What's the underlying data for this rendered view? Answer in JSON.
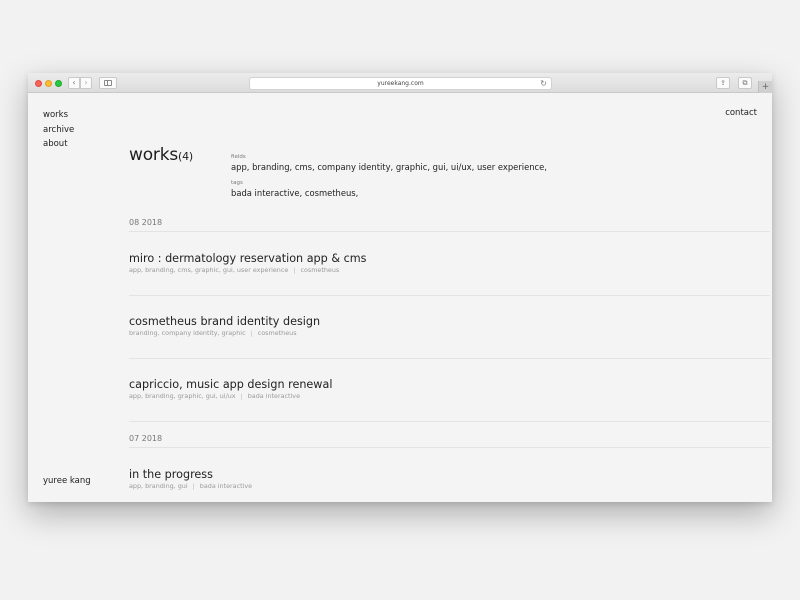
{
  "browser": {
    "url": "yureekang.com",
    "icons": {
      "back": "‹",
      "forward": "›",
      "reload": "↻",
      "share": "⇪",
      "tabs": "⧉",
      "new_tab": "+"
    }
  },
  "nav": {
    "items": [
      {
        "label": "works"
      },
      {
        "label": "archive"
      },
      {
        "label": "about"
      }
    ],
    "contact": "contact",
    "author": "yuree kang"
  },
  "header": {
    "title": "works",
    "count": "(4)",
    "fields_label": "fields",
    "fields_value": "app, branding, cms, company identity, graphic, gui, ui/ux, user experience,",
    "tags_label": "tags",
    "tags_value": "bada interactive, cosmetheus,"
  },
  "groups": [
    {
      "date": "08 2018",
      "projects": [
        {
          "title": "miro : dermatology reservation app & cms",
          "fields": "app, branding, cms, graphic, gui, user experience",
          "sep": "|",
          "tag": "cosmetheus"
        },
        {
          "title": "cosmetheus brand identity design",
          "fields": "branding, company identity, graphic",
          "sep": "|",
          "tag": "cosmetheus"
        },
        {
          "title": "capriccio, music app design renewal",
          "fields": "app, branding, graphic, gui, ui/ux",
          "sep": "|",
          "tag": "bada interactive"
        }
      ]
    },
    {
      "date": "07 2018",
      "projects": [
        {
          "title": "in the progress",
          "fields": "app, branding, gui",
          "sep": "|",
          "tag": "bada interactive"
        }
      ]
    }
  ]
}
